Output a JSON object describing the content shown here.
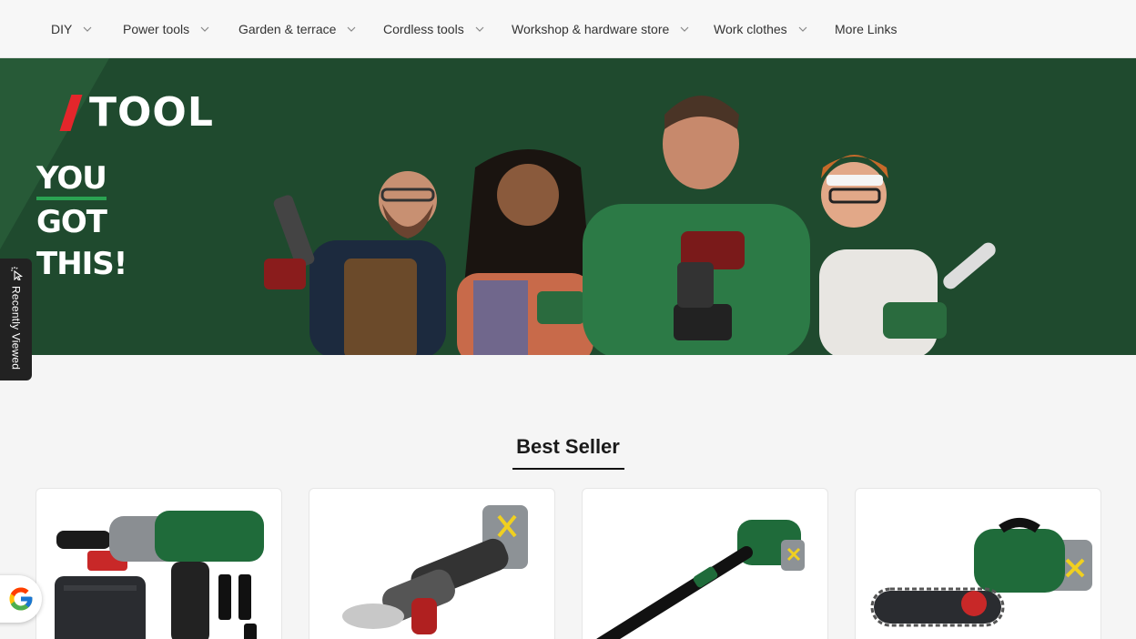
{
  "nav": {
    "items": [
      {
        "label": "DIY",
        "dropdown": true
      },
      {
        "label": "Power tools",
        "dropdown": true
      },
      {
        "label": "Garden & terrace",
        "dropdown": true
      },
      {
        "label": "Cordless tools",
        "dropdown": true
      },
      {
        "label": "Workshop & hardware store",
        "dropdown": true
      },
      {
        "label": "Work clothes",
        "dropdown": true
      },
      {
        "label": "More Links",
        "dropdown": false
      }
    ]
  },
  "banner": {
    "brand": "TOOL",
    "slogan": [
      "YOU",
      "GOT",
      "THIS!"
    ],
    "colors": {
      "background": "#1f4a2e",
      "accent": "#e3262b",
      "underline": "#2aa352"
    }
  },
  "recently_viewed": {
    "label": "Recently Viewed",
    "icon": "cursor-click-icon"
  },
  "best_seller": {
    "title": "Best Seller",
    "products": [
      {
        "icon": "impact-wrench-icon"
      },
      {
        "icon": "angle-grinder-icon"
      },
      {
        "icon": "leaf-blower-icon"
      },
      {
        "icon": "chainsaw-icon"
      }
    ]
  },
  "google_badge": {
    "icon": "google-g-icon"
  }
}
